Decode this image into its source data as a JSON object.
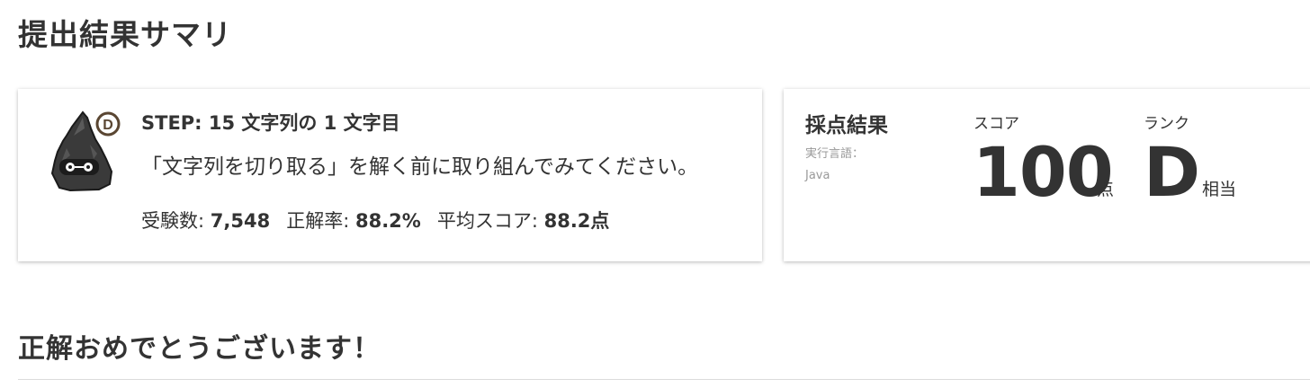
{
  "page": {
    "title": "提出結果サマリ",
    "congrats": "正解おめでとうございます！"
  },
  "problem": {
    "rank_badge": "D",
    "step_title": "STEP: 15 文字列の 1 文字目",
    "description": "「文字列を切り取る」を解く前に取り組んでみてください。",
    "stats": {
      "examinees_label": "受験数: ",
      "examinees_value": "7,548",
      "accuracy_label": "正解率: ",
      "accuracy_value": "88.2%",
      "avg_score_label": "平均スコア: ",
      "avg_score_value": "88.2点"
    }
  },
  "result": {
    "title": "採点結果",
    "language_label": "実行言語：",
    "language_value": "Java",
    "score_label": "スコア",
    "score_value": "100",
    "score_unit": "点",
    "rank_label": "ランク",
    "rank_value": "D",
    "rank_unit": "相当"
  },
  "icons": {
    "monster": "dark-spiky-monster-icon",
    "badge": "rank-d-badge-icon"
  },
  "colors": {
    "text": "#333333",
    "muted": "#999999",
    "monster_body": "#3a3a3a",
    "badge_ring": "#5a4632"
  }
}
